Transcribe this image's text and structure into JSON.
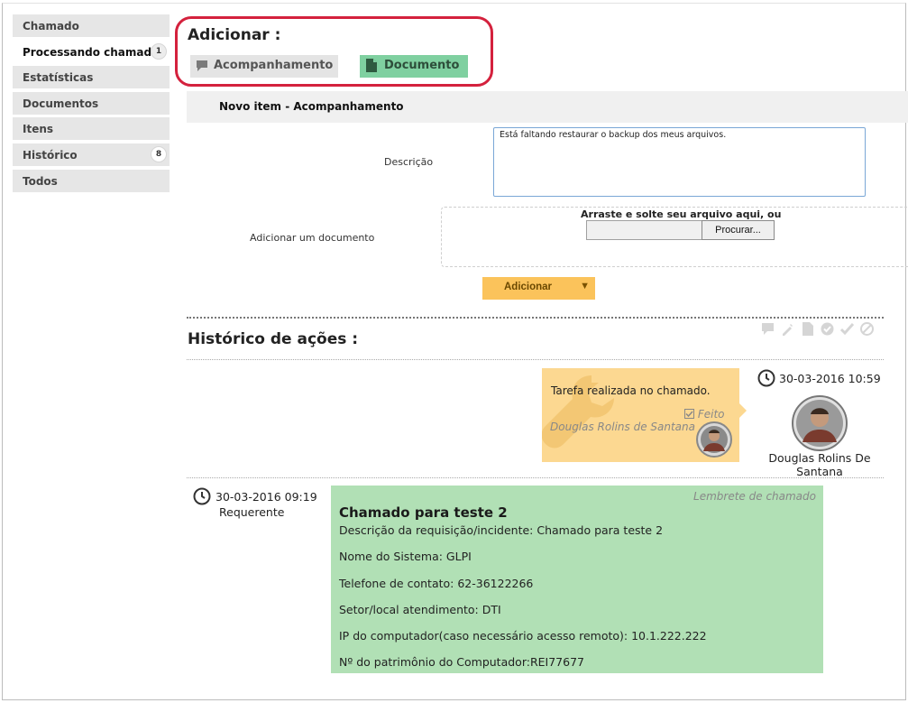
{
  "sidebar": {
    "items": [
      {
        "label": "Chamado",
        "badge": ""
      },
      {
        "label": "Processando chamado",
        "badge": "1"
      },
      {
        "label": "Estatísticas",
        "badge": ""
      },
      {
        "label": "Documentos",
        "badge": ""
      },
      {
        "label": "Itens",
        "badge": ""
      },
      {
        "label": "Histórico",
        "badge": "8"
      },
      {
        "label": "Todos",
        "badge": ""
      }
    ]
  },
  "add": {
    "title": "Adicionar :",
    "followup_label": "Acompanhamento",
    "document_label": "Documento"
  },
  "form": {
    "header": "Novo item - Acompanhamento",
    "description_label": "Descrição",
    "description_value": "Está faltando restaurar o backup dos meus arquivos.",
    "document_label": "Adicionar um documento",
    "drop_text": "Arraste e solte seu arquivo aqui, ou",
    "browse_label": "Procurar...",
    "submit_label": "Adicionar"
  },
  "history": {
    "title": "Histórico de ações :",
    "task": {
      "text": "Tarefa realizada no chamado.",
      "status": "Feito",
      "user": "Douglas Rolins de Santana",
      "datetime": "30-03-2016 10:59",
      "author": "Douglas Rolins De Santana"
    },
    "ticket": {
      "datetime": "30-03-2016 09:19",
      "role": "Requerente",
      "tag": "Lembrete de chamado",
      "title": "Chamado para teste 2",
      "lines": [
        "Descrição da requisição/incidente: Chamado para teste 2",
        "Nome do Sistema: GLPI",
        "Telefone de contato: 62-36122266",
        "Setor/local atendimento: DTI",
        "IP do computador(caso necessário acesso remoto): 10.1.222.222",
        "Nº do patrimônio do Computador:REI77677"
      ]
    }
  },
  "colors": {
    "highlight_border": "#d4213d",
    "document_button": "#7fd0a0",
    "task_card": "#fcd891",
    "ticket_card": "#b1e0b5",
    "submit_button": "#fbc35b"
  }
}
